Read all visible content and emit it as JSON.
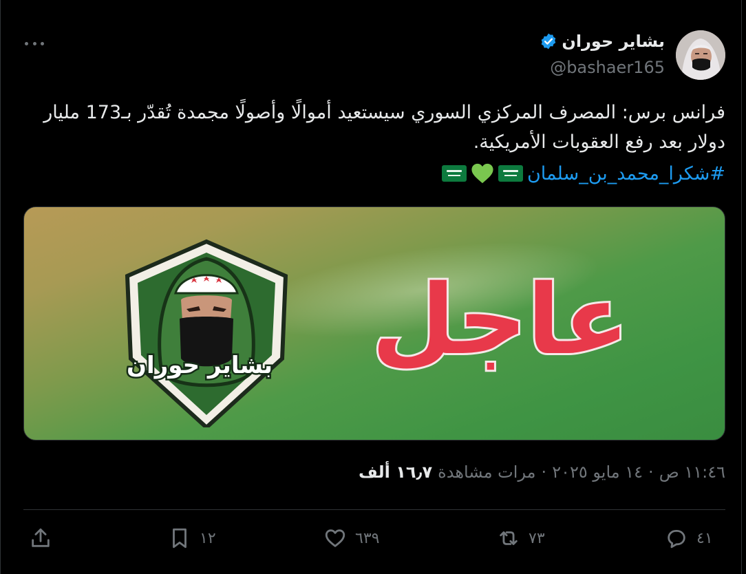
{
  "author": {
    "display_name": "بشاير حوران",
    "handle": "@bashaer165",
    "verified": true
  },
  "tweet": {
    "text": "فرانس برس: المصرف المركزي السوري سيستعيد أموالًا وأصولًا مجمدة تُقدّر بـ173 مليار دولار بعد رفع العقوبات الأمريكية.",
    "hashtag": "#شكرا_محمد_بن_سلمان"
  },
  "media": {
    "headline": "عاجل",
    "logo_text": "بشاير حوران"
  },
  "meta": {
    "time": "١١:٤٦ ص",
    "date": "١٤ مايو ٢٠٢٥",
    "views_count": "١٦٫٧ ألف",
    "views_label": "مرات مشاهدة",
    "separator": "·"
  },
  "actions": {
    "replies": "٤١",
    "reposts": "٧٣",
    "likes": "٦٣٩",
    "bookmarks": "١٢"
  },
  "colors": {
    "background": "#000000",
    "text": "#e7e9ea",
    "muted": "#71767b",
    "accent": "#1d9bf0",
    "verified": "#1d9bf0",
    "breaking_red": "#e8394a"
  },
  "icons": {
    "more": "more-horizontal-icon",
    "verified": "verified-badge-icon",
    "reply": "reply-icon",
    "repost": "repost-icon",
    "like": "heart-icon",
    "bookmark": "bookmark-icon",
    "share": "share-icon"
  }
}
